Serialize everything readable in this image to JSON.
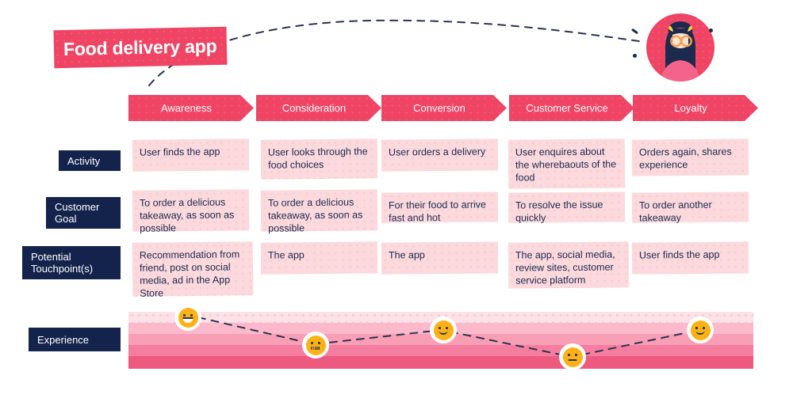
{
  "title": "Food delivery app",
  "avatar": {
    "name": "user-avatar",
    "circle_color": "#ef4464",
    "hair_color": "#1b2a4e",
    "glasses_color": "#f6a04d",
    "clip_color": "#ffd23f",
    "shirt_color": "#f4648a"
  },
  "colors": {
    "accent_pink": "#ef4464",
    "cell_pink": "#fbd9dd",
    "label_navy": "#13234b",
    "emoji_orange": "#fcb116",
    "text_navy": "#1b2a4e"
  },
  "stages": [
    {
      "label": "Awareness"
    },
    {
      "label": "Consideration"
    },
    {
      "label": "Conversion"
    },
    {
      "label": "Customer Service"
    },
    {
      "label": "Loyalty"
    }
  ],
  "rows": [
    {
      "label": "Activity",
      "cells": [
        "User finds the app",
        "User looks through the food choices",
        "User orders a delivery",
        "User enquires about the wherebaouts of the food",
        "Orders again, shares experience"
      ]
    },
    {
      "label": "Customer Goal",
      "cells": [
        "To order a delicious takeaway, as soon as possible",
        "To order a delicious takeaway, as soon as possible",
        "For their food to arrive fast and hot",
        "To resolve the issue quickly",
        "To order another takeaway"
      ]
    },
    {
      "label": "Potential Touchpoint(s)",
      "cells": [
        "Recommendation from friend, post on social media, ad in the App Store",
        "The app",
        "The app",
        "The app, social media, review sites, customer service platform",
        "User finds the app"
      ]
    }
  ],
  "experience": {
    "label": "Experience",
    "bands": [
      {
        "name": "band-very-positive",
        "color": "#fde1e8"
      },
      {
        "name": "band-positive",
        "color": "#fbb9cb"
      },
      {
        "name": "band-neutral",
        "color": "#f89fb6"
      },
      {
        "name": "band-negative",
        "color": "#f57ea0"
      },
      {
        "name": "band-very-negative",
        "color": "#ee5a7f"
      }
    ],
    "points": [
      {
        "stage": "Awareness",
        "mood": "happy",
        "icon": "happy-face-icon"
      },
      {
        "stage": "Consideration",
        "mood": "confused",
        "icon": "confused-face-icon"
      },
      {
        "stage": "Conversion",
        "mood": "smile",
        "icon": "smiling-face-icon"
      },
      {
        "stage": "Customer Service",
        "mood": "sad",
        "icon": "neutral-sad-face-icon"
      },
      {
        "stage": "Loyalty",
        "mood": "smile",
        "icon": "smiling-face-icon"
      }
    ]
  }
}
